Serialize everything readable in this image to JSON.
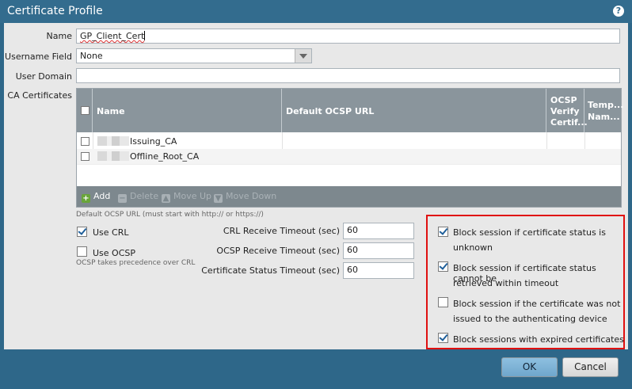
{
  "dialog": {
    "title": "Certificate Profile",
    "help_icon": "?"
  },
  "form": {
    "name_label": "Name",
    "name_value": "GP_Client_Cert",
    "username_field_label": "Username Field",
    "username_field_value": "None",
    "user_domain_label": "User Domain",
    "user_domain_value": "",
    "ca_certificates_label": "CA Certificates"
  },
  "ca_grid": {
    "columns": [
      "Name",
      "Default OCSP URL",
      "OCSP Verify Certif...",
      "Temp... Nam..."
    ],
    "col_ocsp_verify_lines": [
      "OCSP",
      "Verify",
      "Certif..."
    ],
    "col_template_lines": [
      "Temp...",
      "Nam..."
    ],
    "rows": [
      {
        "name": "Issuing_CA"
      },
      {
        "name": "Offline_Root_CA"
      }
    ],
    "toolbar": {
      "add": "Add",
      "delete": "Delete",
      "move_up": "Move Up",
      "move_down": "Move Down"
    }
  },
  "ocsp_hint": "Default OCSP URL (must start with http:// or https://)",
  "options": {
    "use_crl": {
      "label": "Use CRL",
      "checked": true
    },
    "use_ocsp": {
      "label": "Use OCSP",
      "checked": false
    },
    "ocsp_note": "OCSP takes precedence over CRL"
  },
  "timeouts": {
    "crl_label": "CRL Receive Timeout (sec)",
    "crl_value": "60",
    "ocsp_label": "OCSP Receive Timeout (sec)",
    "ocsp_value": "60",
    "cert_status_label": "Certificate Status Timeout (sec)",
    "cert_status_value": "60"
  },
  "block": {
    "unknown_line1": "Block session if certificate status is",
    "unknown_line2": "unknown",
    "timeout_line1": "Block session if certificate status cannot be",
    "timeout_line2": "retrieved within timeout",
    "not_issued_line1": "Block session if the certificate was not",
    "not_issued_line2": "issued to the authenticating device",
    "expired": "Block sessions with expired certificates"
  },
  "buttons": {
    "ok": "OK",
    "cancel": "Cancel"
  },
  "colors": {
    "title_bar": "#336c8e",
    "highlight_box": "#e01010",
    "grid_header": "#8a959c"
  }
}
